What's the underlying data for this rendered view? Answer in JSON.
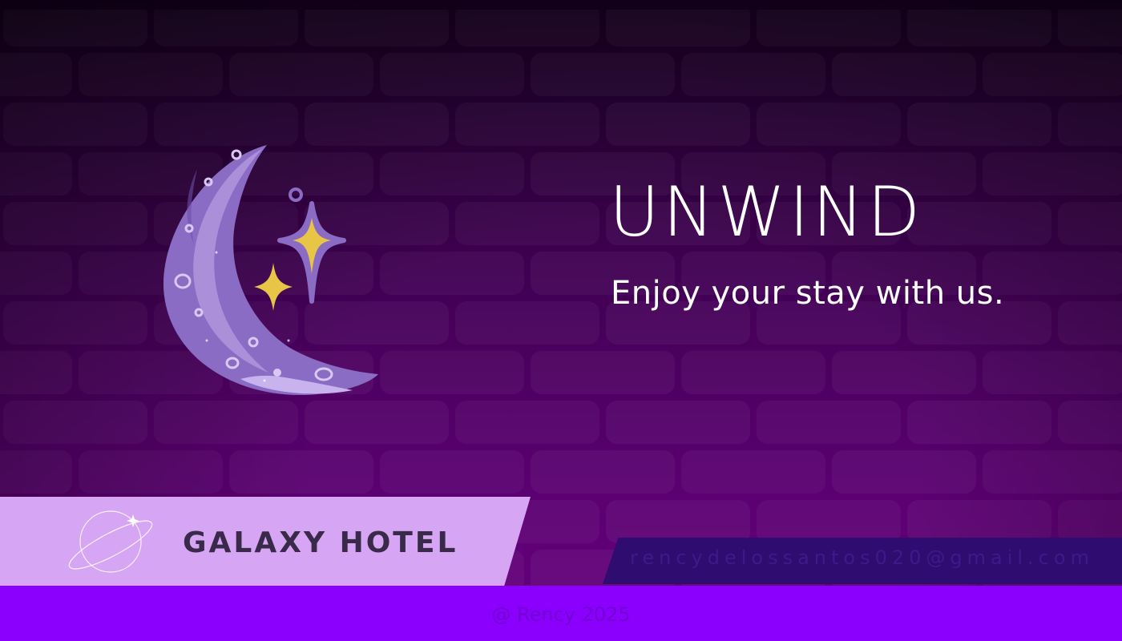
{
  "hero": {
    "headline": "UNWIND",
    "tagline": "Enjoy your stay with us."
  },
  "brand": {
    "name": "GALAXY HOTEL"
  },
  "contact": {
    "email": "rencydelossantos020@gmail.com"
  },
  "footer": {
    "copyright": "@ Rency 2025"
  },
  "icons": [
    "crescent-moon-illustration",
    "sparkle-icon",
    "planet-logo-icon"
  ],
  "colors": {
    "background_top": "#170020",
    "background_bottom": "#66007e",
    "banner": "#d6a6f5",
    "email_banner": "#2f0c70",
    "footer": "#8a00fc",
    "sparkle": "#e8c547",
    "moon": "#8a6cc4"
  }
}
